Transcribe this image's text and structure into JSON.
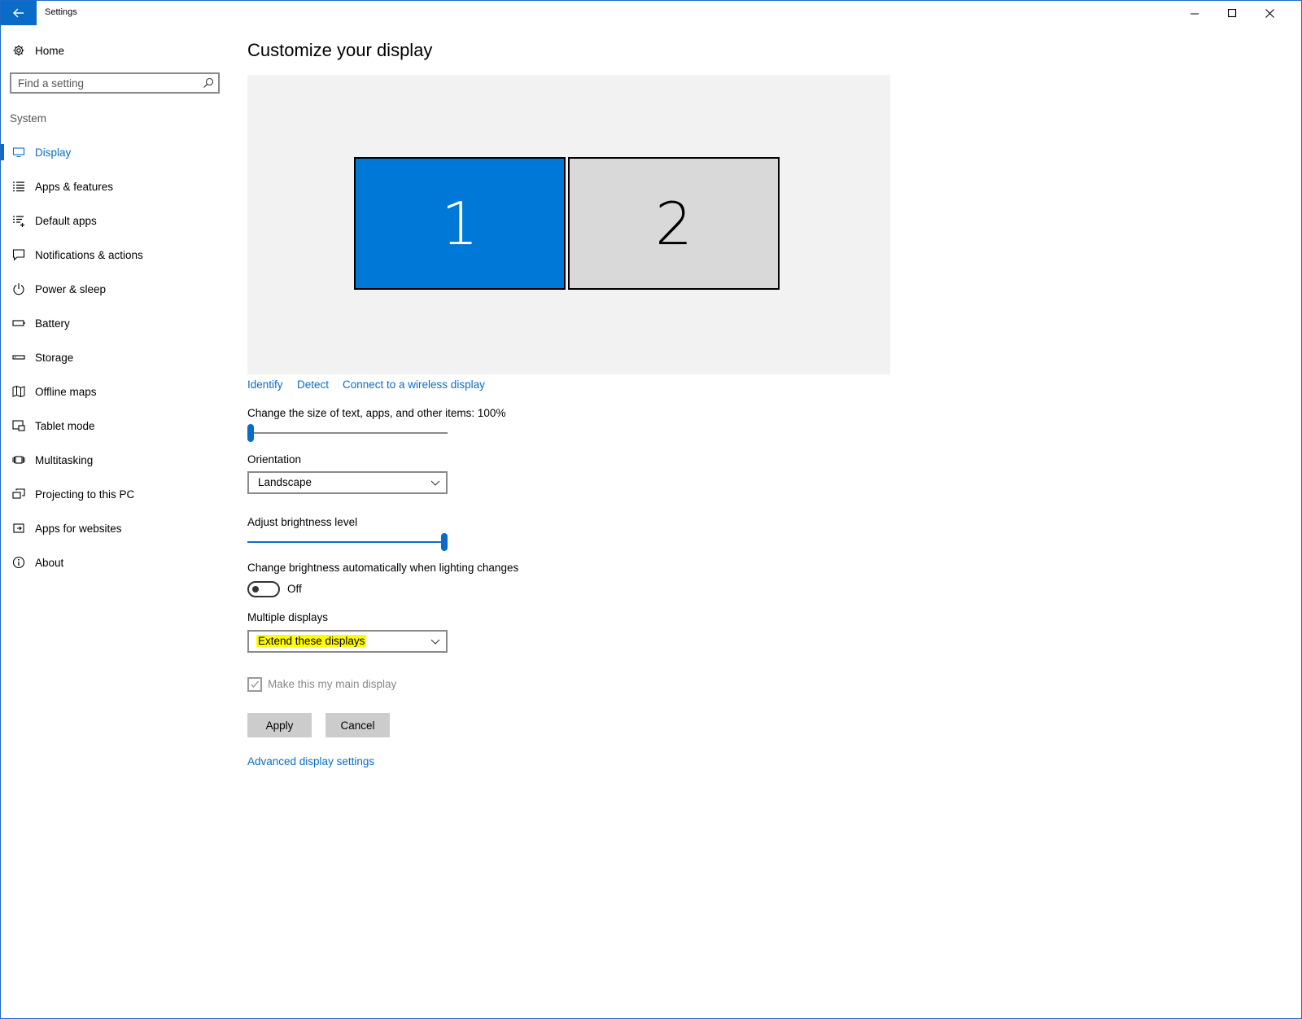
{
  "window": {
    "title": "Settings"
  },
  "sidebar": {
    "home_label": "Home",
    "search_placeholder": "Find a setting",
    "section": "System",
    "items": [
      {
        "label": "Display",
        "icon": "monitor-icon",
        "active": true
      },
      {
        "label": "Apps & features",
        "icon": "list-icon"
      },
      {
        "label": "Default apps",
        "icon": "default-apps-icon"
      },
      {
        "label": "Notifications & actions",
        "icon": "speech-bubble-icon"
      },
      {
        "label": "Power & sleep",
        "icon": "power-icon"
      },
      {
        "label": "Battery",
        "icon": "battery-icon"
      },
      {
        "label": "Storage",
        "icon": "storage-icon"
      },
      {
        "label": "Offline maps",
        "icon": "map-icon"
      },
      {
        "label": "Tablet mode",
        "icon": "tablet-icon"
      },
      {
        "label": "Multitasking",
        "icon": "multitasking-icon"
      },
      {
        "label": "Projecting to this PC",
        "icon": "projecting-icon"
      },
      {
        "label": "Apps for websites",
        "icon": "apps-for-websites-icon"
      },
      {
        "label": "About",
        "icon": "info-icon"
      }
    ]
  },
  "main": {
    "title": "Customize your display",
    "monitors": [
      {
        "label": "1",
        "selected": true
      },
      {
        "label": "2",
        "selected": false
      }
    ],
    "links": {
      "identify": "Identify",
      "detect": "Detect",
      "wireless": "Connect to a wireless display"
    },
    "scale": {
      "label": "Change the size of text, apps, and other items: 100%",
      "value_fraction": 0
    },
    "orientation": {
      "label": "Orientation",
      "value": "Landscape"
    },
    "brightness": {
      "label": "Adjust brightness level",
      "value_fraction": 1
    },
    "auto_brightness": {
      "label": "Change brightness automatically when lighting changes",
      "state": "Off"
    },
    "multiple_displays": {
      "label": "Multiple displays",
      "value": "Extend these displays"
    },
    "main_display": {
      "label": "Make this my main display",
      "checked": true,
      "disabled": true
    },
    "buttons": {
      "apply": "Apply",
      "cancel": "Cancel"
    },
    "advanced_link": "Advanced display settings"
  },
  "colors": {
    "accent": "#0a6cc7",
    "monitor_selected": "#0078d7",
    "monitor_unselected": "#d9d9d9",
    "highlight": "#fffb00"
  }
}
